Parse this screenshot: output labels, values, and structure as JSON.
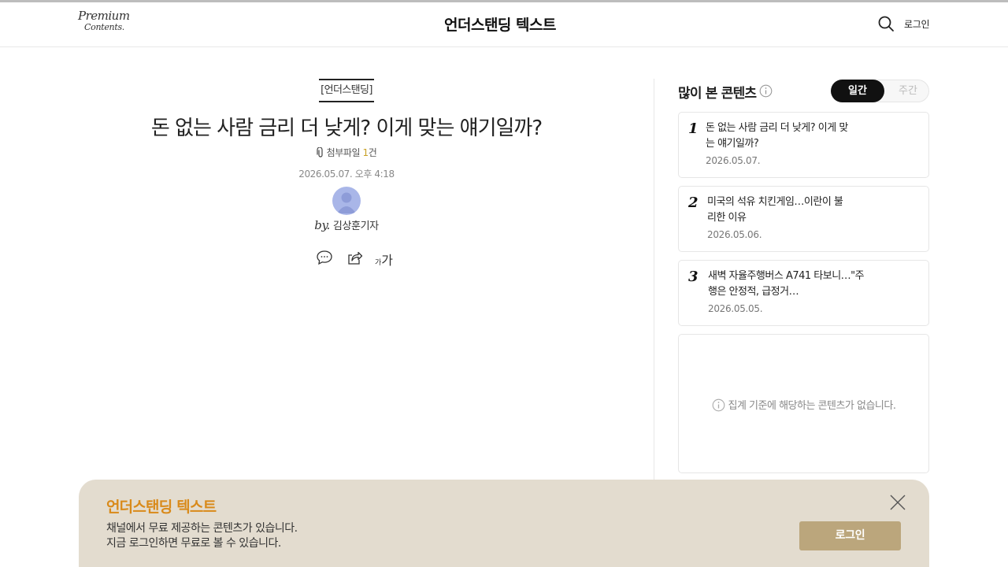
{
  "header": {
    "logo_line1": "Premium",
    "logo_line2": "Contents.",
    "title": "언더스탠딩 텍스트",
    "login_label": "로그인"
  },
  "article": {
    "category": "[언더스탠딩]",
    "title": "돈 없는 사람 금리 더 낮게? 이게 맞는 얘기일까?",
    "attachment_label": "첨부파일",
    "attachment_count": "1",
    "attachment_unit": "건",
    "date": "2026.05.07. 오후 4:18",
    "by_label": "by.",
    "author": "김상훈기자",
    "font_size_small": "가",
    "font_size_large": "가"
  },
  "sidebar": {
    "title": "많이 본 콘텐츠",
    "tabs": [
      "일간",
      "주간"
    ],
    "selected_tab": "일간",
    "items": [
      {
        "rank": "1",
        "title": "돈 없는 사람 금리 더 낮게? 이게 맞는 얘기일까?",
        "date": "2026.05.07."
      },
      {
        "rank": "2",
        "title": "미국의 석유 치킨게임…이란이 불리한 이유",
        "date": "2026.05.06."
      },
      {
        "rank": "3",
        "title": "새벽 자율주행버스 A741 타보니…\"주행은 안정적, 급정거…",
        "date": "2026.05.05."
      }
    ],
    "empty_message": "집계 기준에 해당하는 콘텐츠가 없습니다."
  },
  "banner": {
    "title": "언더스탠딩 텍스트",
    "line1": "채널에서 무료 제공하는 콘텐츠가 있습니다.",
    "line2": "지금 로그인하면 무료로 볼 수 있습니다.",
    "login_label": "로그인"
  },
  "icons": {
    "search": "search-icon",
    "info": "info-icon",
    "comment": "comment-icon",
    "share": "share-icon",
    "close": "close-icon",
    "clip": "paperclip-icon"
  },
  "colors": {
    "banner_bg": "#e3dccf",
    "banner_title": "#d98a1a",
    "banner_button": "#bba67c",
    "toggle_active": "#111111",
    "avatar": "#a9b6e8"
  }
}
